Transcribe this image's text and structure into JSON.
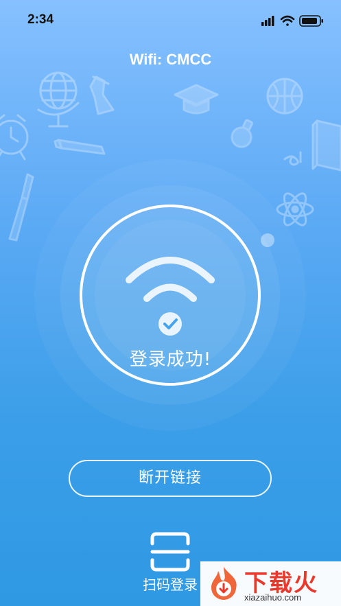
{
  "status_bar": {
    "time": "2:34",
    "icons": [
      "signal-icon",
      "wifi-icon",
      "battery-icon"
    ]
  },
  "header": {
    "wifi_title": "Wifi: CMCC"
  },
  "main": {
    "status_icon": "wifi-check-icon",
    "success_text": "登录成功!",
    "disconnect_label": "断开链接",
    "scan_label": "扫码登录",
    "scan_icon": "scan-frame-icon"
  },
  "decorations": [
    "globe-icon",
    "flask-icon",
    "graduation-cap-icon",
    "basketball-icon",
    "alarm-clock-icon",
    "pencil-icon",
    "lightbulb-icon",
    "book-icon",
    "paintbrush-icon",
    "atom-icon",
    "music-note-icon"
  ],
  "watermark": {
    "title": "下载火",
    "site": "xiazaihuo.com"
  },
  "colors": {
    "background_top": "#86c0ff",
    "background_bottom": "#2f99e4",
    "foreground": "#ffffff",
    "watermark_red": "#e8392c"
  }
}
